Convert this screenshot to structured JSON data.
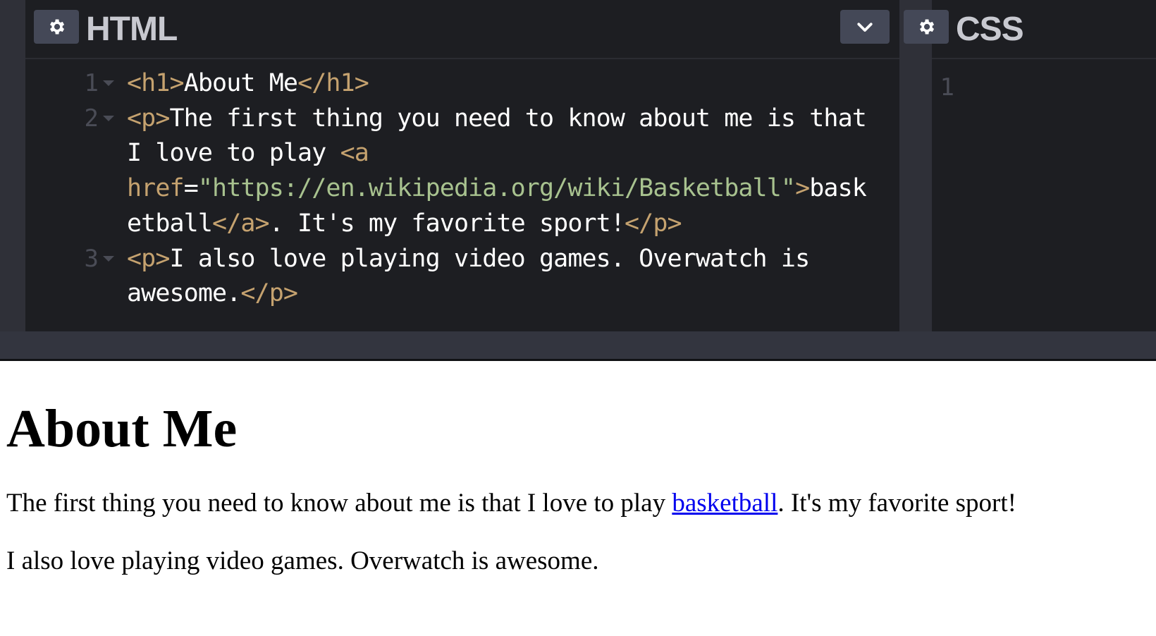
{
  "editor": {
    "html_panel": {
      "title": "HTML",
      "lines": [
        {
          "number": "1",
          "tokens": [
            {
              "t": "<h1>",
              "c": "tag"
            },
            {
              "t": "About Me",
              "c": "plain"
            },
            {
              "t": "</h1>",
              "c": "tag"
            }
          ]
        },
        {
          "number": "2",
          "tokens": [
            {
              "t": "<p>",
              "c": "tag"
            },
            {
              "t": "The first thing you need to know about me is that",
              "c": "plain"
            }
          ]
        },
        {
          "number": "",
          "tokens": [
            {
              "t": "I love to play ",
              "c": "plain"
            },
            {
              "t": "<a",
              "c": "tag"
            }
          ]
        },
        {
          "number": "",
          "tokens": [
            {
              "t": "href",
              "c": "attr"
            },
            {
              "t": "=",
              "c": "plain"
            },
            {
              "t": "\"https://en.wikipedia.org/wiki/Basketball\"",
              "c": "str"
            },
            {
              "t": ">",
              "c": "tag"
            },
            {
              "t": "bask",
              "c": "plain"
            }
          ]
        },
        {
          "number": "",
          "tokens": [
            {
              "t": "etball",
              "c": "plain"
            },
            {
              "t": "</a>",
              "c": "tag"
            },
            {
              "t": ". It's my favorite sport!",
              "c": "plain"
            },
            {
              "t": "</p>",
              "c": "tag"
            }
          ]
        },
        {
          "number": "3",
          "tokens": [
            {
              "t": "<p>",
              "c": "tag"
            },
            {
              "t": "I also love playing video games. Overwatch is",
              "c": "plain"
            }
          ]
        },
        {
          "number": "",
          "tokens": [
            {
              "t": "awesome.",
              "c": "plain"
            },
            {
              "t": "</p>",
              "c": "tag"
            }
          ]
        }
      ]
    },
    "css_panel": {
      "title": "CSS",
      "line_number": "1"
    },
    "icons": {
      "settings": "gear-icon",
      "collapse": "chevron-down-icon"
    },
    "colors": {
      "editor_bg": "#1d1e22",
      "tag": "#c5a26f",
      "string": "#a8c28f",
      "link": "#0000ee"
    }
  },
  "preview": {
    "heading": "About Me",
    "paragraph1_before": "The first thing you need to know about me is that I love to play ",
    "paragraph1_link": "basketball",
    "paragraph1_after": ". It's my favorite sport!",
    "paragraph2": "I also love playing video games. Overwatch is awesome."
  }
}
